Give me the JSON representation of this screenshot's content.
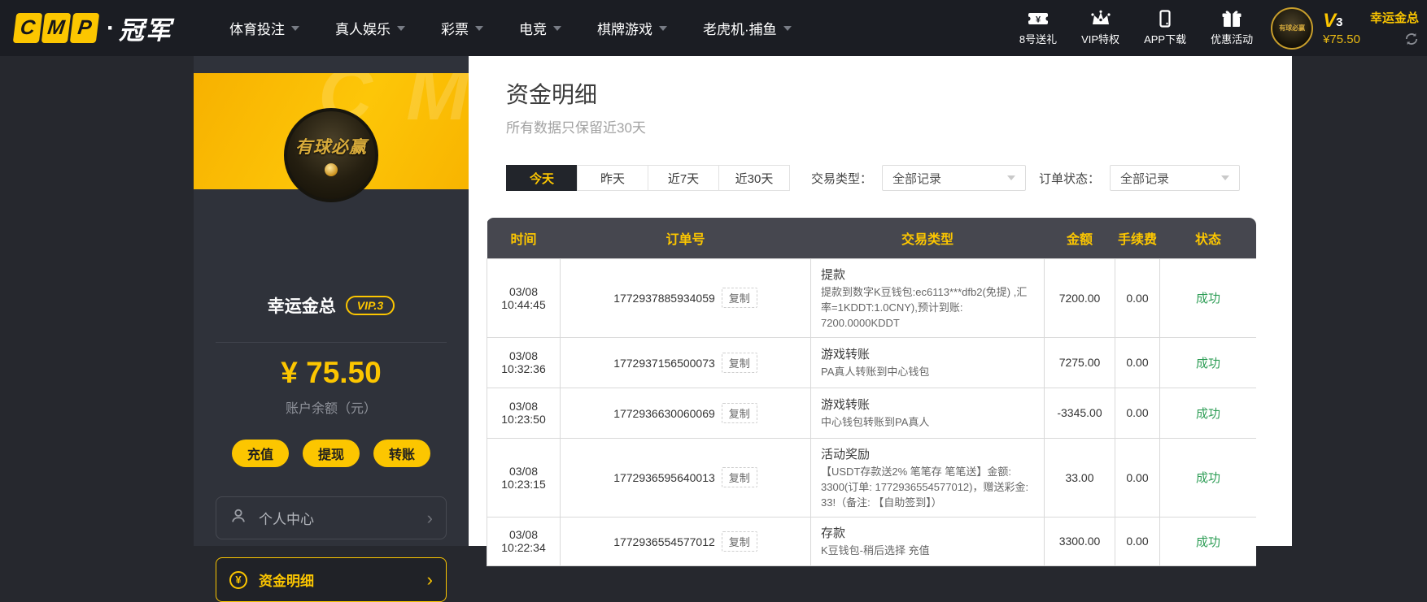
{
  "colors": {
    "accent": "#fcc600",
    "success": "#2f9e57",
    "topbar_bg": "#1b1d23",
    "table_header_bg": "#46474f"
  },
  "navbar": {
    "logo": {
      "letters": [
        "C",
        "M",
        "P"
      ],
      "dot": "·",
      "suffix": "冠军"
    },
    "menu": [
      {
        "label": "体育投注"
      },
      {
        "label": "真人娱乐"
      },
      {
        "label": "彩票"
      },
      {
        "label": "电竞"
      },
      {
        "label": "棋牌游戏"
      },
      {
        "label": "老虎机·捕鱼"
      }
    ],
    "quick_links": [
      {
        "label": "8号送礼",
        "icon": "ticket-icon"
      },
      {
        "label": "VIP特权",
        "icon": "crown-icon"
      },
      {
        "label": "APP下载",
        "icon": "phone-icon"
      },
      {
        "label": "优惠活动",
        "icon": "gift-icon"
      }
    ],
    "user": {
      "avatar_text": "有球必赢",
      "vip_letter": "V",
      "vip_level": "3",
      "balance": "¥75.50",
      "username": "幸运金总"
    }
  },
  "sidebar": {
    "avatar_text": "有球必赢",
    "username": "幸运金总",
    "vip_badge": "VIP.3",
    "balance": "¥ 75.50",
    "balance_label": "账户余额（元）",
    "actions": [
      {
        "label": "充值"
      },
      {
        "label": "提现"
      },
      {
        "label": "转账"
      }
    ],
    "menu": [
      {
        "label": "个人中心",
        "icon": "user-icon",
        "active": false
      },
      {
        "label": "资金明细",
        "icon": "yuan-circle-icon",
        "active": true
      }
    ]
  },
  "main": {
    "title": "资金明细",
    "subtitle": "所有数据只保留近30天",
    "date_tabs": [
      {
        "label": "今天",
        "active": true
      },
      {
        "label": "昨天",
        "active": false
      },
      {
        "label": "近7天",
        "active": false
      },
      {
        "label": "近30天",
        "active": false
      }
    ],
    "filters": [
      {
        "label": "交易类型：",
        "value": "全部记录"
      },
      {
        "label": "订单状态：",
        "value": "全部记录"
      }
    ],
    "table": {
      "headers": [
        "时间",
        "订单号",
        "交易类型",
        "金额",
        "手续费",
        "状态"
      ],
      "copy_label": "复制",
      "rows": [
        {
          "time": "03/08 10:44:45",
          "order": "1772937885934059",
          "type": "提款",
          "desc": "提款到数字K豆钱包:ec6113***dfb2(免提) ,汇率=1KDDT:1.0CNY),预计到账: 7200.0000KDDT",
          "amount": "7200.00",
          "fee": "0.00",
          "status": "成功"
        },
        {
          "time": "03/08 10:32:36",
          "order": "1772937156500073",
          "type": "游戏转账",
          "desc": "PA真人转账到中心钱包",
          "amount": "7275.00",
          "fee": "0.00",
          "status": "成功"
        },
        {
          "time": "03/08 10:23:50",
          "order": "1772936630060069",
          "type": "游戏转账",
          "desc": "中心钱包转账到PA真人",
          "amount": "-3345.00",
          "fee": "0.00",
          "status": "成功"
        },
        {
          "time": "03/08 10:23:15",
          "order": "1772936595640013",
          "type": "活动奖励",
          "desc": "【USDT存款送2% 笔笔存 笔笔送】金额: 3300(订单: 1772936554577012)，赠送彩金: 33!（备注: 【自助签到】）",
          "amount": "33.00",
          "fee": "0.00",
          "status": "成功"
        },
        {
          "time": "03/08 10:22:34",
          "order": "1772936554577012",
          "type": "存款",
          "desc": "K豆钱包-稍后选择 充值",
          "amount": "3300.00",
          "fee": "0.00",
          "status": "成功"
        }
      ]
    }
  }
}
